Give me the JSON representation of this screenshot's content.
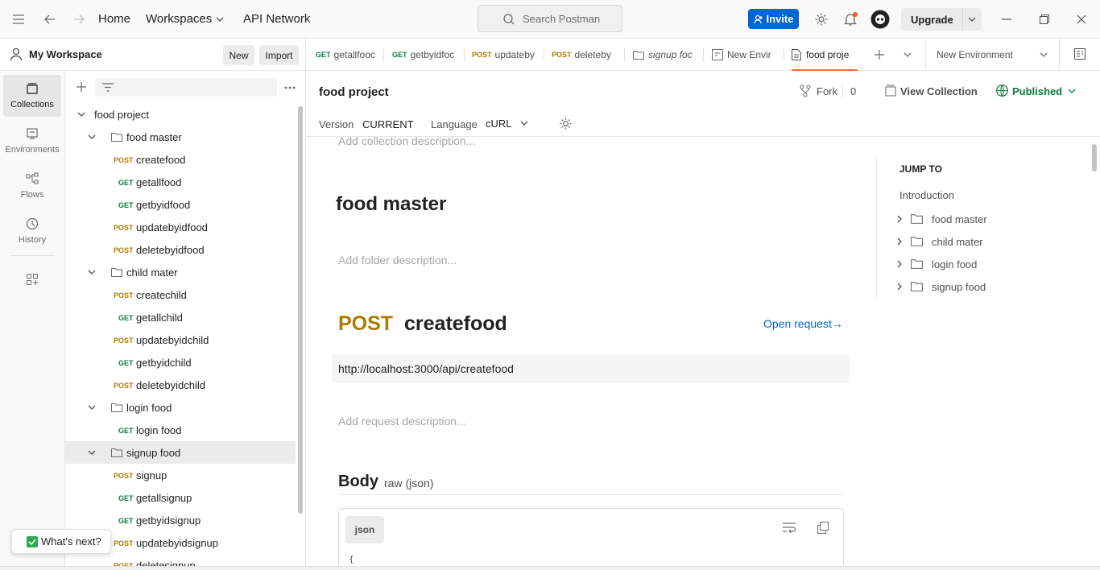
{
  "topbar": {
    "home": "Home",
    "workspaces": "Workspaces",
    "api_network": "API Network",
    "search_placeholder": "Search Postman",
    "invite": "Invite",
    "upgrade": "Upgrade"
  },
  "workspace": {
    "name": "My Workspace",
    "new_label": "New",
    "import_label": "Import"
  },
  "tabs": [
    {
      "method": "GET",
      "label": "getallfooc"
    },
    {
      "method": "GET",
      "label": "getbyidfoc"
    },
    {
      "method": "POST",
      "label": "updateby"
    },
    {
      "method": "POST",
      "label": "deleteby"
    },
    {
      "method": "",
      "label": "signup foc"
    },
    {
      "method": "",
      "label": "New Envir"
    },
    {
      "method": "",
      "label": "food proje"
    }
  ],
  "environment": "New Environment",
  "rail": {
    "collections": "Collections",
    "environments": "Environments",
    "flows": "Flows",
    "history": "History"
  },
  "tree": {
    "root": "food project",
    "folders": [
      {
        "name": "food master",
        "items": [
          {
            "method": "POST",
            "name": "createfood"
          },
          {
            "method": "GET",
            "name": "getallfood"
          },
          {
            "method": "GET",
            "name": "getbyidfood"
          },
          {
            "method": "POST",
            "name": "updatebyidfood"
          },
          {
            "method": "POST",
            "name": "deletebyidfood"
          }
        ]
      },
      {
        "name": "child mater",
        "items": [
          {
            "method": "POST",
            "name": "createchild"
          },
          {
            "method": "GET",
            "name": "getallchild"
          },
          {
            "method": "POST",
            "name": "updatebyidchild"
          },
          {
            "method": "GET",
            "name": "getbyidchild"
          },
          {
            "method": "POST",
            "name": "deletebyidchild"
          }
        ]
      },
      {
        "name": "login food",
        "items": [
          {
            "method": "GET",
            "name": "login food"
          }
        ]
      },
      {
        "name": "signup food",
        "items": [
          {
            "method": "POST",
            "name": "signup"
          },
          {
            "method": "GET",
            "name": "getallsignup"
          },
          {
            "method": "GET",
            "name": "getbyidsignup"
          },
          {
            "method": "POST",
            "name": "updatebyidsignup"
          },
          {
            "method": "POST",
            "name": "deletesignup"
          }
        ]
      }
    ]
  },
  "whats_next": "What's next?",
  "collection": {
    "title": "food project",
    "fork_label": "Fork",
    "fork_count": "0",
    "view_collection": "View Collection",
    "published": "Published",
    "version_label": "Version",
    "version_value": "CURRENT",
    "language_label": "Language",
    "language_value": "cURL",
    "collection_desc_placeholder": "Add collection description..."
  },
  "doc": {
    "folder_title": "food master",
    "folder_desc_placeholder": "Add folder description...",
    "request_method": "POST",
    "request_name": "createfood",
    "open_request": "Open request→",
    "url": "http://localhost:3000/api/createfood",
    "request_desc_placeholder": "Add request description...",
    "body_title": "Body",
    "body_type": "raw (json)",
    "json_label": "json",
    "code_first": "{"
  },
  "jump": {
    "title": "JUMP TO",
    "intro": "Introduction",
    "folders": [
      "food master",
      "child mater",
      "login food",
      "signup food"
    ]
  },
  "colors": {
    "get": "#0b7a3e",
    "post": "#ad7a03",
    "accent": "#ff6c37",
    "invite": "#0265d2",
    "published": "#0b7a3e"
  }
}
